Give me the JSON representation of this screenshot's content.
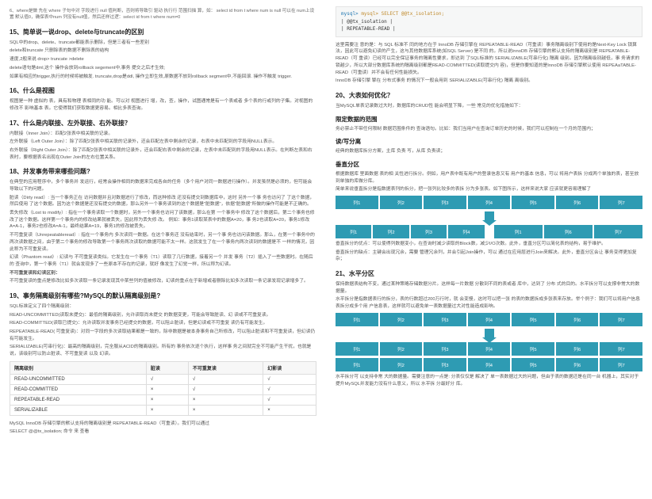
{
  "left": {
    "q6": "6、where是做 先在 where 子句中对 字段进行 null 值判断，否则将导致引 驱动 执行行 范围扫描 算，如： select id from t where num is null 可以在 num上设置 默认值0，确保表中num 列没有null值，然后还样过逻：select id from t where num=0",
    "q15": {
      "title": "15、简单说一说drop、delete与truncate的区别",
      "l1": "SQL中的drop、delete、truncate都能表示删除，但是三者有一些差别",
      "l2": "delete和truncate 只删除表的数据不删除表的结构",
      "l3": "速度,2般来说 drop> truncate >delete",
      "l4": "delete语句是dml,这个 操作会放到rollback segement中,事务 提交之后才生效;",
      "l5": "如果有相应的trigger,执行的时候将被触发. truncate,drop是ddl, 操作立即生效,原数据不放到rollback segment中,不能回滚. 操作不触发 trigger."
    },
    "q16": {
      "title": "16、什么是视图",
      "body": "视图是一种 虚拟的 表，具有和物理 表相同的功 能。可以对 视图进行 增，改，查，操作，试图通常是有一个表或者 多个表的行或列的子集。对视图的修改不 影响基本 表。它使得我们获取数据更容易。相比多表查询。"
    },
    "q17": {
      "title": "17、什么是内联接、左外联接、右外联接？",
      "l1": "内联接（Inner Join）：匹配2张表中相关联的记录。",
      "l2": "左外联接（Left Outer Join）：除了匹配2张表中相关联的记录外，还会匹配左表中剩余的记录，右表中未匹配到的字段用NULL表示。",
      "l3": "右外联接（Right Outer Join）：除了匹配2张表中相关联的记录外，还会匹配右表中剩余的记录，左表中未匹配到的字段用NULL表示。在判断左表和右表时，要根据表名出现在Outer Join的左右位置关系。"
    },
    "q18": {
      "title": "18、并发事务带来哪些问题?",
      "intro": "在典型的应用程序中，多个事务并 发运行，经常会操作相同的数据来完成各自的任务（多个用户对同一数据进行操作）。并发虽然是必须的，但可能会导致以下的问题。",
      "l1": "脏读（Dirty read）: 当一个事务正在 访问数据并且对数据进行了修改，而这种修改 还没有提交到数据库中，这时 另外一个事 务也访问了 了这个数据， 然后使用 了这个数据。因为这个数据是还没有提交的数据，那么另外一个事务读到的这个数据是\"脏数据\"，依据\"脏数据\"所做的操作可能是不正确的。",
      "l2": "丢失修改（Lost to modify）: 指在一个事务读取一个数据时，另外一个事务也访问了该数据，那么在第 一个事务中 修改了这个数据后，第二个事务也修改了这个数据。这样第一个事务内的修改结果就被丢失，因此称为丢失修 改。 例如：事务1读取某表中的数据A=20，事 务2也读取A=20，事务1修改A=A-1，事务2也修改A=A-1，最终结果A=19，事务1的修改被丢失。",
      "l3": "不可重复读（Unrepeatableread）: 指在一个事务内 多次读同一数据。在这个事务还 没有结束时，另一个事 务也访问该数据。那么，在第一个事务中的两次读数据之间，由于第二个事务的修改导致第一个事务两次读取的数据可能不太一样。这就发生了在一个事务内两次读到的数据是不 一样的情况，因此称为不可重复读。",
      "l4": "幻读（Phantom read）: 幻读与 不可重复读类似。它发生在一个事务（T1）读取了几行数据，接着另一个 并发 事务（T2）插入了一些数据时。在随后的 查询中，第一个事务（T1）就会发现多了一些原本不存在的记录，就好 像发生了幻觉一样，所以称为幻读。",
      "diff": "不可重复读和幻读区别：",
      "diffbody": "不可重复读的重点是修改比如多次读取一条记录发现其中某些列的值被修改，幻读的重点在于新增或者删除比如多次读取一条记录发现记录增多了。"
    },
    "q19": {
      "title": "19、事务隔离级别有哪些?MySQL的默认隔离级别是?",
      "l1": "SQL标准定义了四个隔离级别：",
      "l2": "READ-UNCOMMITTED(读取未提交)：最低的隔离级别，允许读取尚未提交 的数据变更，可能会导致脏读、幻 读或不可重复读。",
      "l3": "READ-COMMITTED(读取已提交)：允许读取并发事务已经提交的数据，可以阻止脏读，但是幻读或不可重复 读仍有可能发生。",
      "l4": "REPEATABLE-READ( 可重复读)：对同一字段的多次读取结果都是一致的，除非数据是被本身事务自己所修改，可以阻止脏读和不可重复读，但幻读仍有可能发生。",
      "l5": "SERIALIZABLE(可串行化)：最高的隔离级别，完全服从ACID的隔离级别。所有的 事务依次逐个执行，这样事 务之间就完全不可能产生干扰，也就是 说，该级别可以防止脏读、不可重复读 以及 幻读。",
      "table": {
        "headers": [
          "隔离级别",
          "脏读",
          "不可重复读",
          "幻影读"
        ],
        "rows": [
          {
            "c0": "READ-UNCOMMITTED",
            "c1": "√",
            "c2": "√",
            "c3": "√"
          },
          {
            "c0": "READ-COMMITTED",
            "c1": "×",
            "c2": "√",
            "c3": "√"
          },
          {
            "c0": "REPEATABLE-READ",
            "c1": "×",
            "c2": "×",
            "c3": "√"
          },
          {
            "c0": "SERIALIZABLE",
            "c1": "×",
            "c2": "×",
            "c3": "×"
          }
        ]
      },
      "foot1": "MySQL InnoDB 存储引擎的默认支持的隔离级别是 REPEATABLE-READ（可重读）。我们可以通过",
      "foot2": "SELECT @@tx_isolation; 命令 来 查看"
    }
  },
  "right": {
    "code": {
      "l1": "mysql> SELECT @@tx_isolation;",
      "l2": "| @@tx_isolation    |",
      "l3": "| REPEATABLE-READ |"
    },
    "p1": "这里需要注 意的是：与 SQL 标准不 同的地方在于 InnoDB 存储引擎在 REPEATABLE-READ（可重读）事务隔离级别下使用的是Next-Key Lock 锁算法，因此可以避免幻读的产生，这与其他数据库系统(如SQL Server) 是不同 的。所以说InnoDB 存储引擎的默认支持的隔离级别是 REPEATABLE-READ（可 重读）已经可以完全保证事务的隔离性要求，即达到 了SQL标准的 SERIALIZABLE(可串行化) 隔离 级别。因为隔离级别越低，事 务请求的锁越少，所以大部分数据库系统的隔离级别都是READ-COMMITTED(读取提交内 容)，但是你要知道的是InnoDB 存储引擎默认使用 REPEAaTABLE-READ（可重读）并不会有任何性能损失。",
    "p2": "InnoDB 存储引擎 擎在 分布式事务 的情况下一般会用到 SERIALIZABLE(可串行化) 隔离 离级别。",
    "q20": {
      "title": "20、大表如何优化？",
      "l1": "当MySQL单表记录数过大时，数据库的CRUD性 能会明显下降，一些 常见的优化措施如下：",
      "s1": "限定数据的范围",
      "l2": "务必禁止不带任何限制 数据范围条件的 查询语句。比如：我们当用户在查询订单历史的时候，我们可以控制在一个月的范围内；",
      "s2": "读/写分离",
      "l3": "经典的数据库拆分方案，主库 负责 写，从库 负责读；",
      "s3": "垂直分区",
      "l4": "根据数据库 里面数据 表的相 关性进行拆分。例如，用户表中既有用户的登录信息又有 用户的基本 信息，可以 将用户表拆 分成两个单独的表，甚至放到单独的库做分库。",
      "l5": "简单来说垂直拆分是指数据表列的拆分，把一张列比较多的表拆 分为多张表。如下图所示，这样来说大家 应该就更容易理解了",
      "cols7": [
        "列1",
        "列2",
        "列3",
        "列4",
        "列5",
        "列6",
        "列7"
      ],
      "group1": [
        "列1",
        "列2",
        "列3",
        "列4"
      ],
      "group2": [
        "列1",
        "列6",
        "列7"
      ],
      "l6": "垂直拆分的优点：可以使得列数据变小，在查询时减少读取的Block数，减少I/O次数。此外，垂直分区可以简化表的结构，易于维护。",
      "l7": "垂直拆分的缺点：主键会出现冗余，需要 管理冗余列，并会引起Join操作，可以 通过在应用层进行Join来解决。此外，垂直分区会让 事务变得更加复杂；"
    },
    "q21": {
      "title": "21、水平分区",
      "l1": "保持数据表结构不变，通过某种策略存储数据分片。这样每一片数据 分散到不同的表或者 库中，达到了 分布 式的目的。水平拆分可以支撑非常大的数据量。",
      "l2": "水平拆分是指数据表行的拆分，表的行数超过200万行时，就 会变慢，这时可以把一张 的表的数据拆成多张表来存放。举个例子：我们可以将用户信息表拆分成多个用 户信息表，这样就可以避免单一表数据量过大对性能造成影响。",
      "cols7": [
        "列1",
        "列2",
        "列3",
        "列4",
        "列5",
        "列6",
        "列7"
      ],
      "l3": "水平拆分可 以支持非常 大的数据量。需要注意的一点是: 分表仅仅是 解决了 单一表数据过大的问题，但由于表的数据还是在同一台 机器上，其实对于提升MySQL并发能力没有什么意义，所以 水平拆 分最好分 库。"
    }
  }
}
